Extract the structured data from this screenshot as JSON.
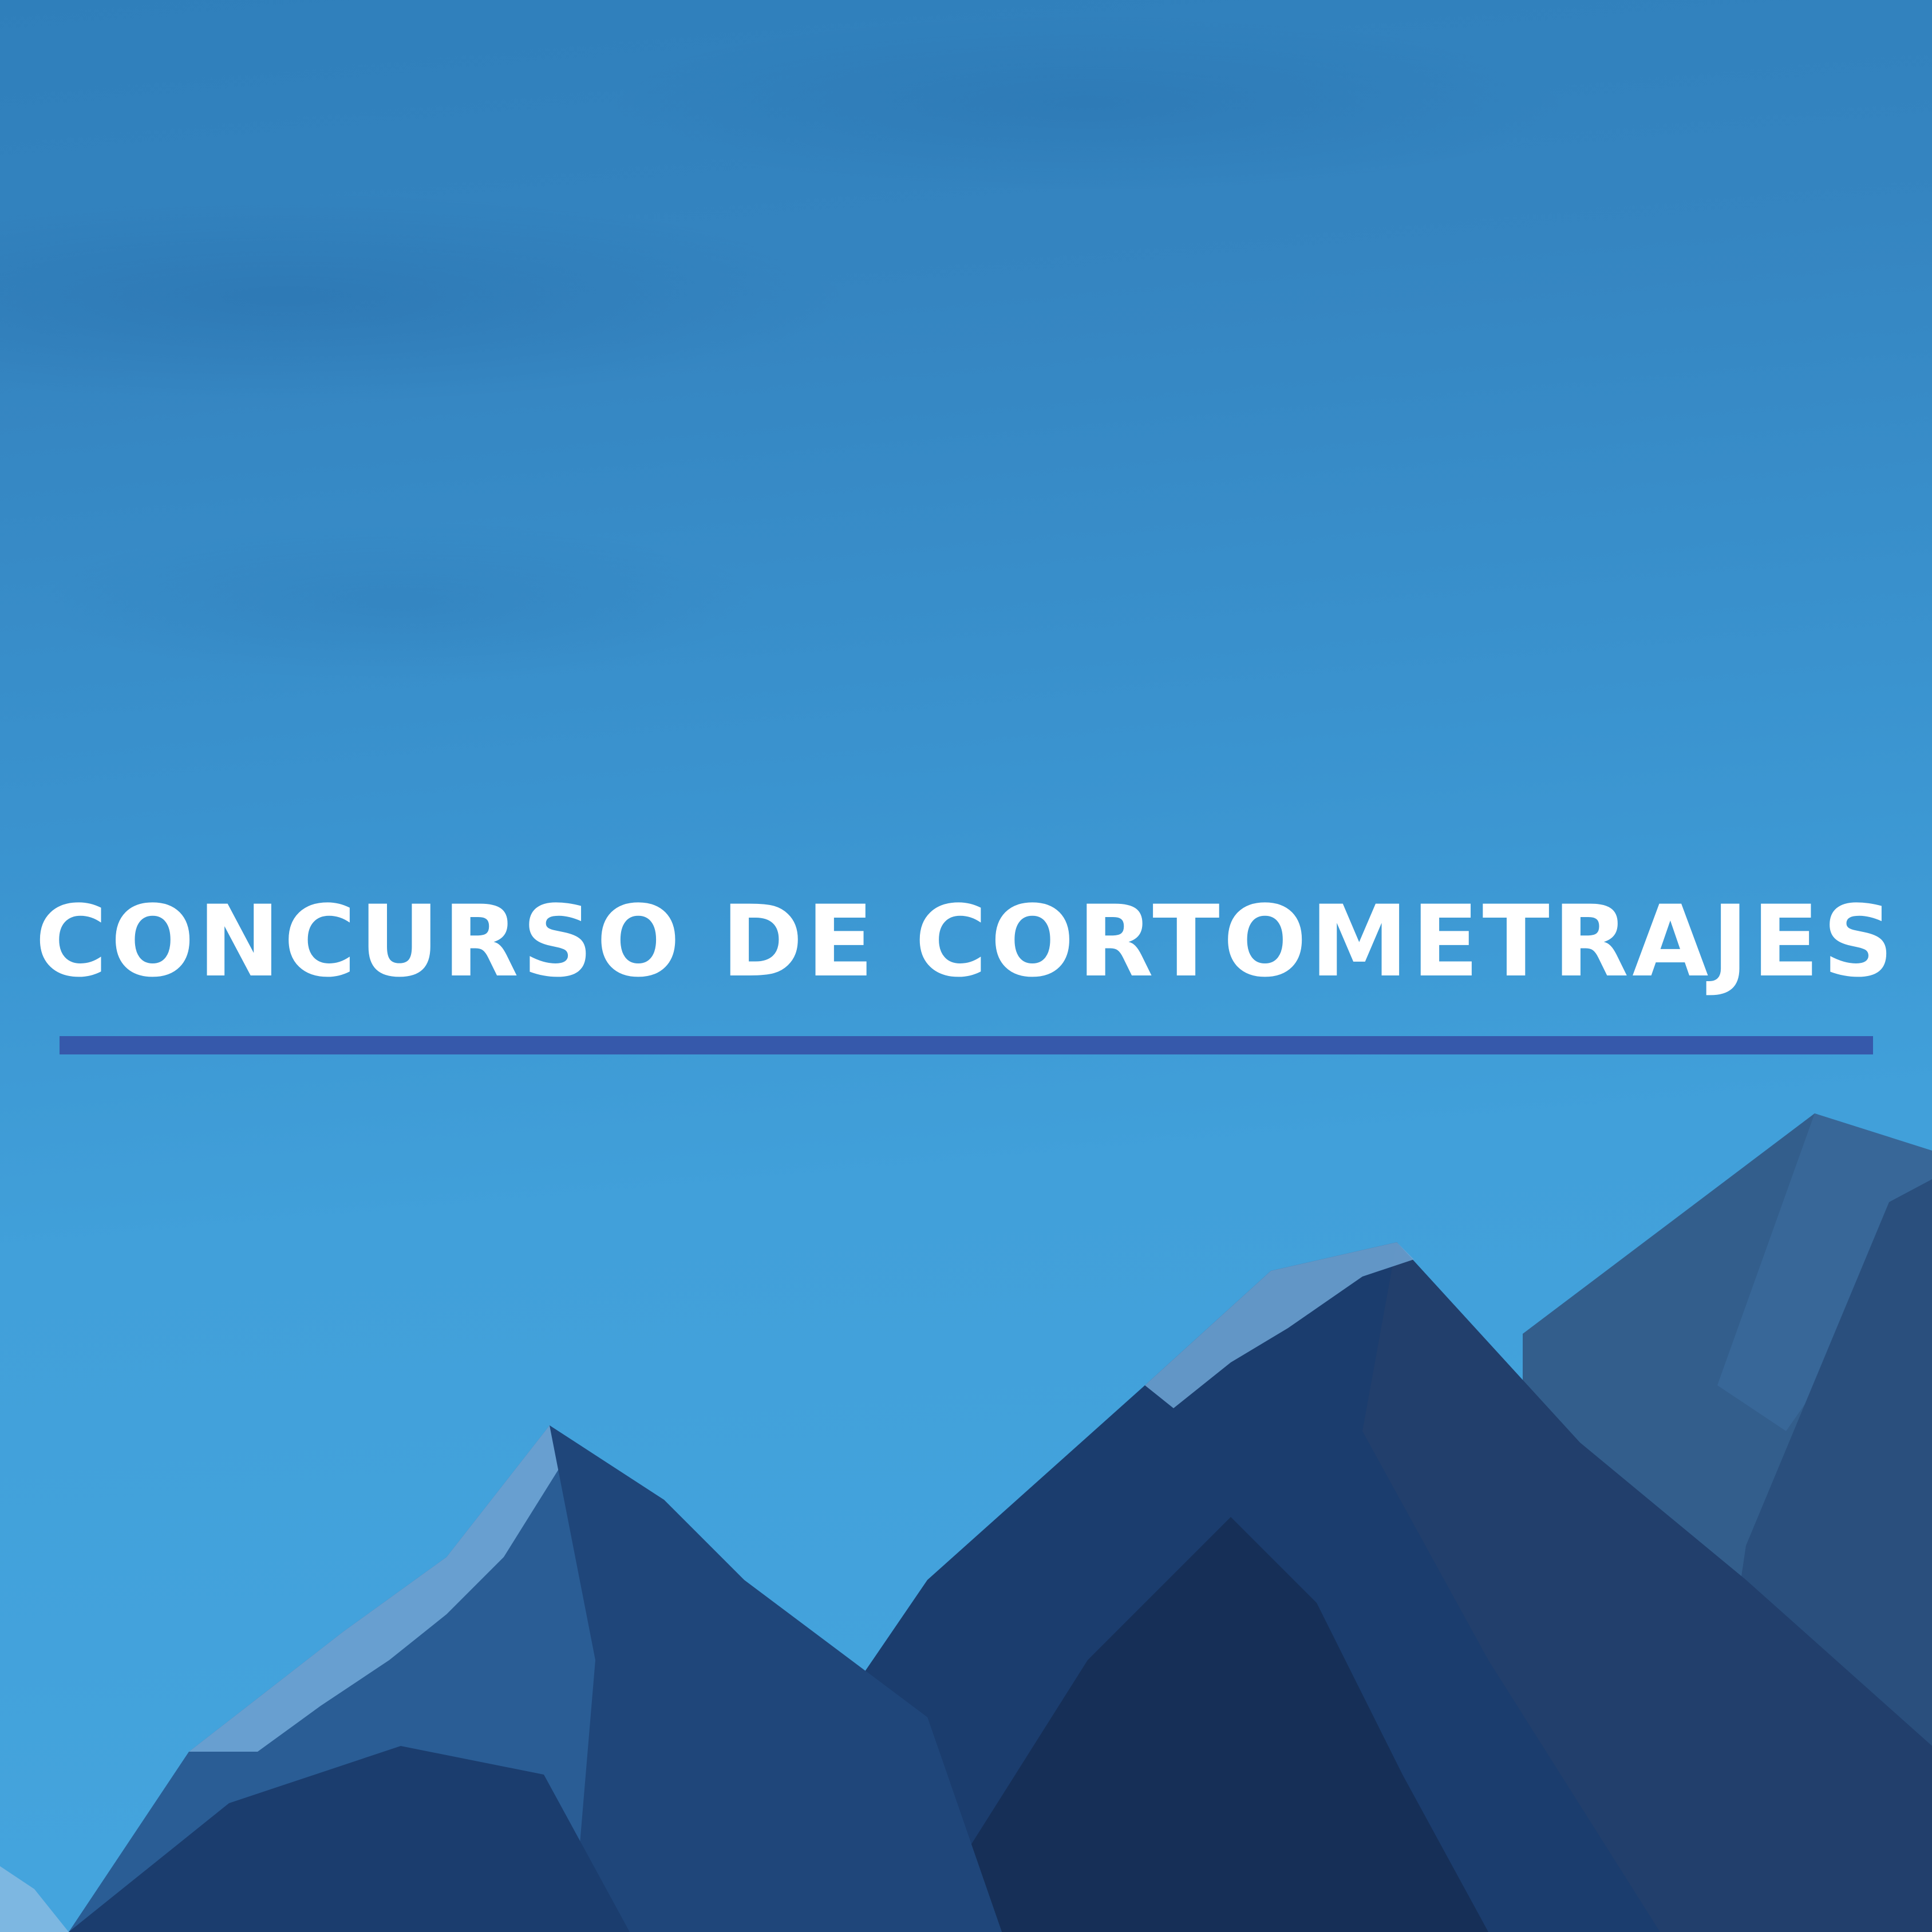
{
  "poster": {
    "title": "CONCURSO DE CORTOMETRAJES"
  },
  "colors": {
    "sky_top": "#2f7fbb",
    "sky_bottom": "#45a5de",
    "title_text": "#ffffff",
    "divider": "#3659ab",
    "mountain_dark": "#1b3d6e",
    "mountain_mid": "#2a5d95",
    "mountain_far": "#335e8c",
    "snow": "#6fa6d6"
  }
}
